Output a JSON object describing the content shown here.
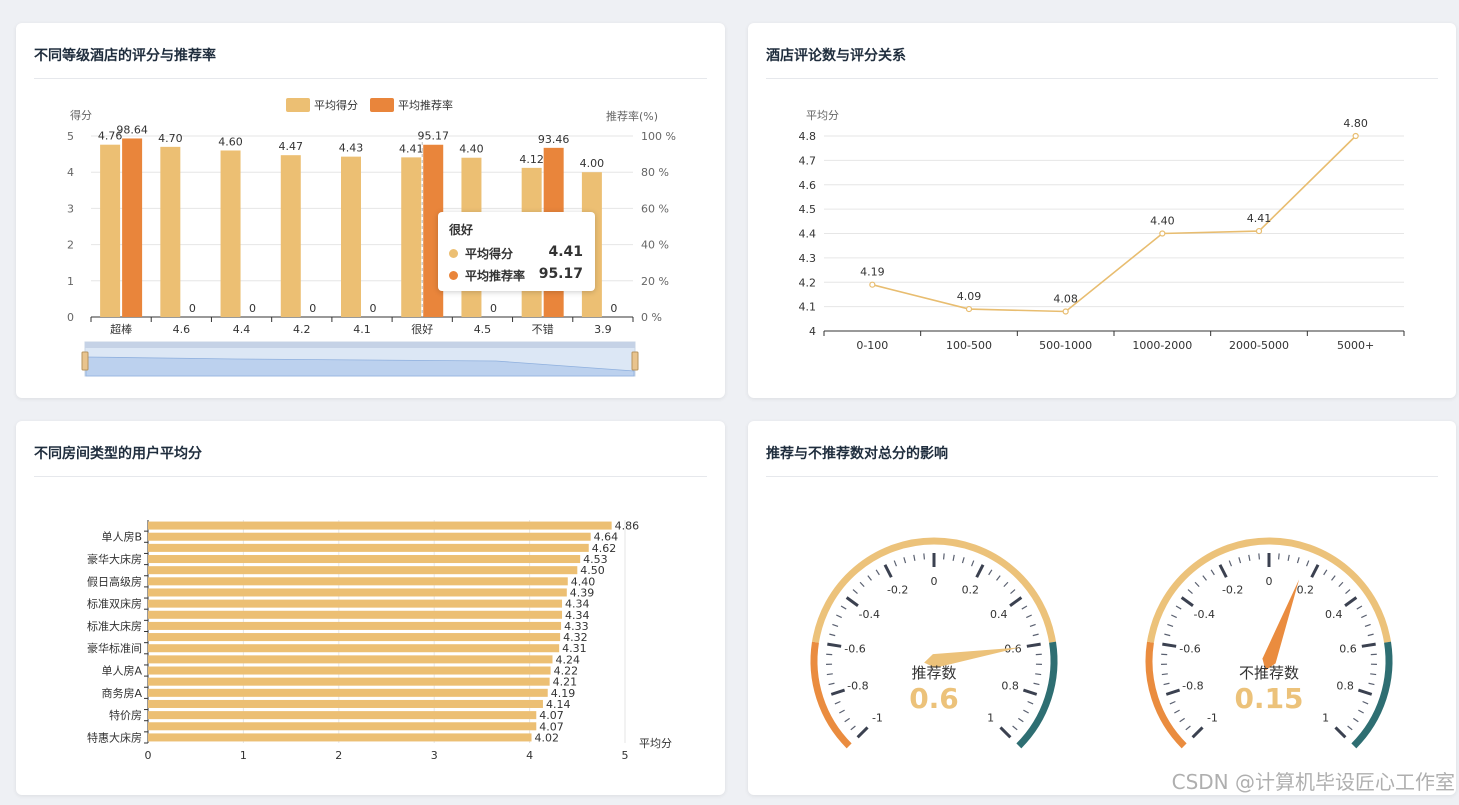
{
  "colors": {
    "score": "#ecbf73",
    "rate": "#e9853b",
    "line": "#e8bd70",
    "gauge_warm": "#ecc27a",
    "gauge_hot": "#ea8c3f",
    "gauge_cool": "#2e6e72",
    "axis": "#666666"
  },
  "card1": {
    "title": "不同等级酒店的评分与推荐率",
    "legend": [
      "平均得分",
      "平均推荐率"
    ],
    "tooltip": {
      "title": "很好",
      "rows": [
        {
          "name": "平均得分",
          "value": "4.41"
        },
        {
          "name": "平均推荐率",
          "value": "95.17"
        }
      ]
    }
  },
  "card2": {
    "title": "酒店评论数与评分关系"
  },
  "card3": {
    "title": "不同房间类型的用户平均分"
  },
  "card4": {
    "title": "推荐与不推荐数对总分的影响"
  },
  "watermark": "CSDN @计算机毕设匠心工作室",
  "chart_data": [
    {
      "type": "bar",
      "categories": [
        "超棒",
        "4.6",
        "4.4",
        "4.2",
        "4.1",
        "很好",
        "4.5",
        "不错",
        "3.9"
      ],
      "series": [
        {
          "name": "平均得分",
          "values": [
            4.76,
            4.7,
            4.6,
            4.47,
            4.43,
            4.41,
            4.4,
            4.12,
            4.0
          ]
        },
        {
          "name": "平均推荐率",
          "values": [
            98.64,
            0,
            0,
            0,
            0,
            95.17,
            0,
            93.46,
            0
          ]
        }
      ],
      "ylabel": "得分",
      "ylim": [
        0,
        5
      ],
      "yticks": [
        "0",
        "1",
        "2",
        "3",
        "4",
        "5"
      ],
      "y2label": "推荐率(%)",
      "y2lim": [
        0,
        100
      ],
      "y2ticks": [
        "0 %",
        "20 %",
        "40 %",
        "60 %",
        "80 %",
        "100 %"
      ],
      "legend": "top-center",
      "grid": true,
      "datazoom": true
    },
    {
      "type": "line",
      "categories": [
        "0-100",
        "100-500",
        "500-1000",
        "1000-2000",
        "2000-5000",
        "5000+"
      ],
      "values": [
        4.19,
        4.09,
        4.08,
        4.4,
        4.41,
        4.8
      ],
      "ylabel": "平均分",
      "ylim": [
        4,
        4.8
      ],
      "yticks": [
        "4",
        "4.1",
        "4.2",
        "4.3",
        "4.4",
        "4.5",
        "4.6",
        "4.7",
        "4.8"
      ],
      "grid": true
    },
    {
      "type": "bar",
      "orientation": "horizontal",
      "categories": [
        "特惠大床房",
        "",
        "特价房",
        "",
        "商务房A",
        "",
        "单人房A",
        "",
        "豪华标准间",
        "",
        "标准大床房",
        "",
        "标准双床房",
        "",
        "假日高级房",
        "",
        "豪华大床房",
        "",
        "单人房B",
        ""
      ],
      "values": [
        4.02,
        4.07,
        4.07,
        4.14,
        4.19,
        4.21,
        4.22,
        4.24,
        4.31,
        4.32,
        4.33,
        4.34,
        4.34,
        4.39,
        4.4,
        4.5,
        4.53,
        4.62,
        4.64,
        4.86
      ],
      "xlabel": "平均分",
      "xlim": [
        0,
        5
      ],
      "xticks": [
        "0",
        "1",
        "2",
        "3",
        "4",
        "5"
      ],
      "grid": true
    },
    {
      "type": "gauge",
      "gauges": [
        {
          "name": "推荐数",
          "value": 0.6,
          "display": "0.6"
        },
        {
          "name": "不推荐数",
          "value": 0.15,
          "display": "0.15"
        }
      ],
      "min": -1,
      "max": 1,
      "ticks": [
        "-1",
        "-0.8",
        "-0.6",
        "-0.4",
        "-0.2",
        "0",
        "0.2",
        "0.4",
        "0.6",
        "0.8",
        "1"
      ]
    }
  ]
}
